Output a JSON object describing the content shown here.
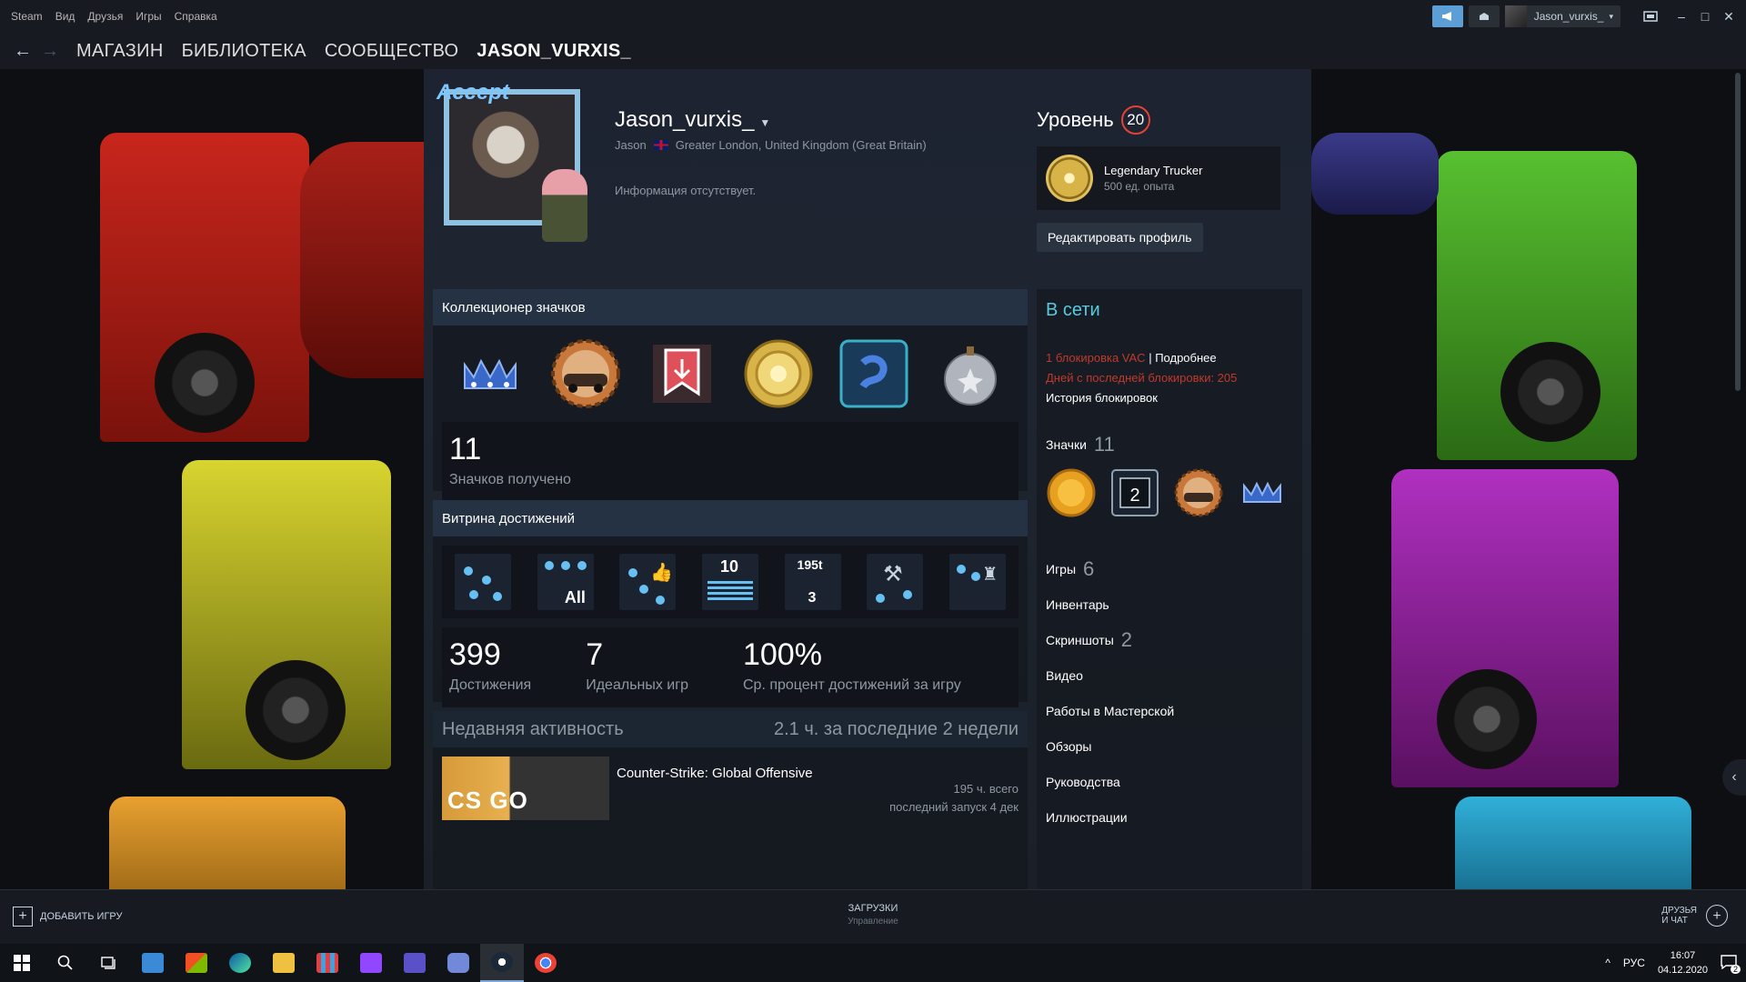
{
  "titlebar": {
    "menu": [
      "Steam",
      "Вид",
      "Друзья",
      "Игры",
      "Справка"
    ],
    "username": "Jason_vurxis_"
  },
  "nav": {
    "links": [
      "МАГАЗИН",
      "БИБЛИОТЕКА",
      "СООБЩЕСТВО",
      "JASON_VURXIS_"
    ]
  },
  "profile": {
    "avatar_text": "Accept",
    "name": "Jason_vurxis_",
    "real_name": "Jason",
    "location": "Greater London, United Kingdom (Great Britain)",
    "summary": "Информация отсутствует.",
    "level_label": "Уровень",
    "level": "20",
    "fav_badge_name": "Legendary Trucker",
    "fav_badge_xp": "500 ед. опыта",
    "edit_button": "Редактировать профиль"
  },
  "badge_collector": {
    "title": "Коллекционер значков",
    "count": "11",
    "count_label": "Значков получено"
  },
  "achievements": {
    "title": "Витрина достижений",
    "icon_labels": [
      "All",
      "10",
      "195t",
      "3"
    ],
    "stats": [
      {
        "value": "399",
        "label": "Достижения"
      },
      {
        "value": "7",
        "label": "Идеальных игр"
      },
      {
        "value": "100%",
        "label": "Ср. процент достижений за игру"
      }
    ]
  },
  "activity": {
    "title": "Недавняя активность",
    "summary": "2.1 ч. за последние 2 недели",
    "game_logo": "CS GO",
    "game_name": "Counter-Strike: Global Offensive",
    "hours_total": "195 ч. всего",
    "last_played": "последний запуск 4 дек"
  },
  "side": {
    "status": "В сети",
    "vac_ban": "1 блокировка VAC",
    "vac_sep": "|",
    "vac_more": "Подробнее",
    "days_since": "Дней с последней блокировки: 205",
    "ban_history": "История блокировок",
    "badges_label": "Значки",
    "badges_count": "11",
    "badge_two": "2",
    "links": [
      {
        "label": "Игры",
        "count": "6"
      },
      {
        "label": "Инвентарь",
        "count": ""
      },
      {
        "label": "Скриншоты",
        "count": "2"
      },
      {
        "label": "Видео",
        "count": ""
      },
      {
        "label": "Работы в Мастерской",
        "count": ""
      },
      {
        "label": "Обзоры",
        "count": ""
      },
      {
        "label": "Руководства",
        "count": ""
      },
      {
        "label": "Иллюстрации",
        "count": ""
      }
    ]
  },
  "bottom": {
    "add_game": "ДОБАВИТЬ ИГРУ",
    "downloads": "ЗАГРУЗКИ",
    "downloads_sub": "Управление",
    "friends_line1": "ДРУЗЬЯ",
    "friends_line2": "И ЧАТ"
  },
  "taskbar": {
    "lang": "РУС",
    "time": "16:07",
    "date": "04.12.2020",
    "notif_count": "2"
  },
  "colors": {
    "accent_blue": "#66c0f4",
    "online": "#57cbde",
    "vac_red": "#c0392b",
    "level_ring": "#e34234"
  }
}
